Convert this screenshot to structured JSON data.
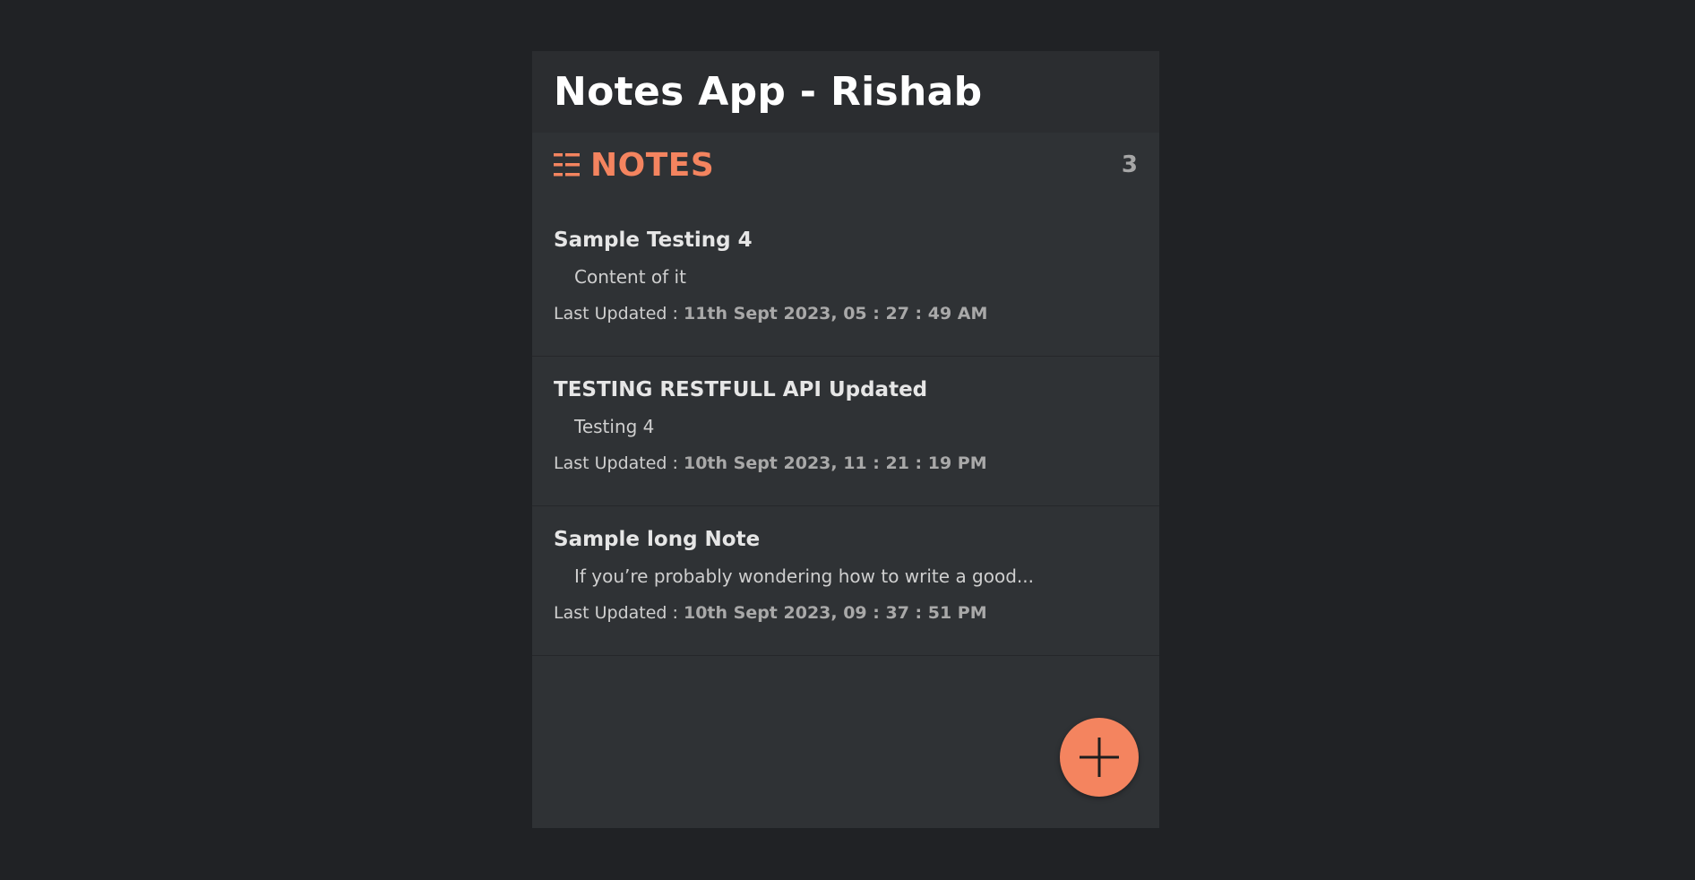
{
  "app": {
    "title": "Notes App - Rishab"
  },
  "notes_header": {
    "icon": "list-icon",
    "label": "NOTES",
    "count": "3",
    "accent_color": "#f4845f"
  },
  "notes": [
    {
      "title": "Sample Testing 4",
      "content": "Content of it",
      "updated_label": "Last Updated : ",
      "updated_value": "11th Sept 2023, 05 : 27 : 49 AM"
    },
    {
      "title": "TESTING RESTFULL API Updated",
      "content": "Testing 4",
      "updated_label": "Last Updated : ",
      "updated_value": "10th Sept 2023, 11 : 21 : 19 PM"
    },
    {
      "title": "Sample long Note",
      "content": "If you’re probably wondering how to write a good...",
      "updated_label": "Last Updated : ",
      "updated_value": "10th Sept 2023, 09 : 37 : 51 PM"
    }
  ],
  "fab": {
    "icon": "plus-icon",
    "color": "#f4845f"
  }
}
